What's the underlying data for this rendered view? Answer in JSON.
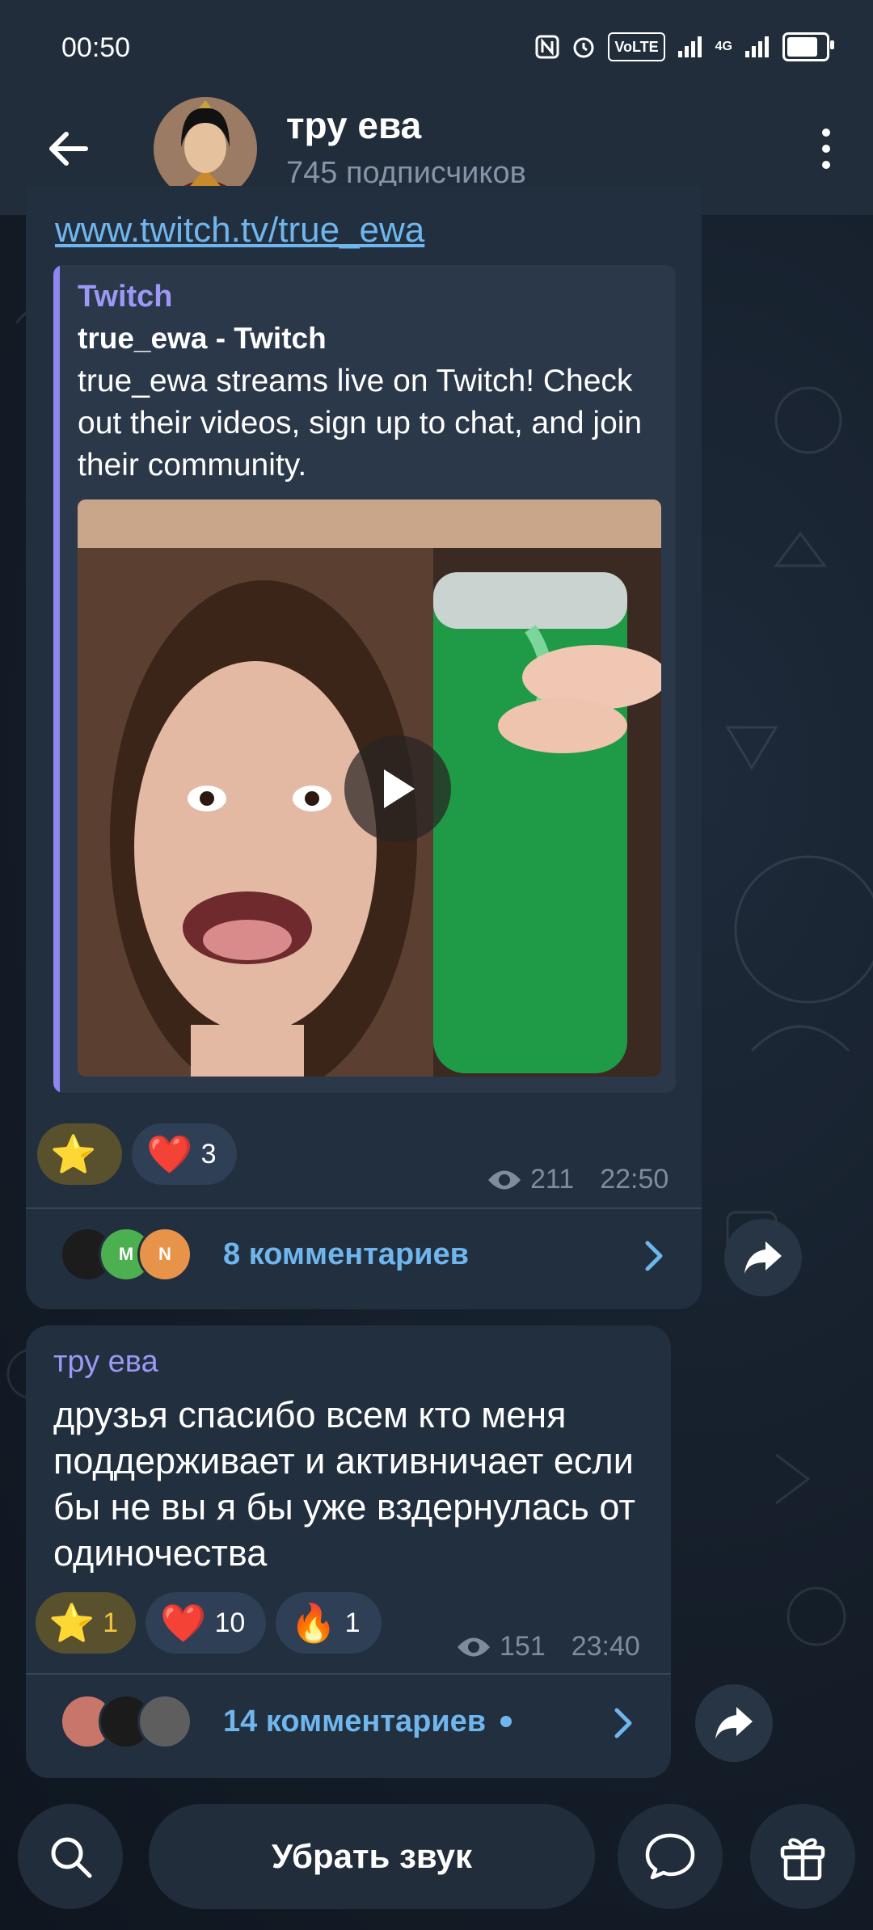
{
  "status_bar": {
    "time": "00:50",
    "network": "4G",
    "volte": "VoLTE",
    "battery_level": 0.8
  },
  "header": {
    "channel_name": "тру ева",
    "subscribers": "745 подписчиков",
    "back_icon": "arrow-left-icon",
    "menu_icon": "more-vertical-icon"
  },
  "post1": {
    "link": "www.twitch.tv/true_ewa",
    "preview": {
      "site": "Twitch",
      "title": "true_ewa - Twitch",
      "description": "true_ewa streams live on Twitch! Check out their videos, sign up to chat, and join their community."
    },
    "reactions": [
      {
        "emoji": "⭐",
        "count": ""
      },
      {
        "emoji": "❤️",
        "count": "3"
      }
    ],
    "views": "211",
    "time": "22:50",
    "comment_avatars": [
      "",
      "M",
      "N"
    ],
    "comments": "8 комментариев"
  },
  "post2": {
    "author": "тру ева",
    "text": "друзья спасибо всем кто меня поддерживает и активничает если бы не вы я бы уже вздернулась от одиночества",
    "reactions": [
      {
        "emoji": "⭐",
        "count": "1"
      },
      {
        "emoji": "❤️",
        "count": "10"
      },
      {
        "emoji": "🔥",
        "count": "1"
      }
    ],
    "views": "151",
    "time": "23:40",
    "comments": "14 комментариев"
  },
  "bottom_bar": {
    "mute_label": "Убрать звук",
    "search_icon": "search-icon",
    "chat_icon": "chat-bubble-icon",
    "gift_icon": "gift-icon"
  },
  "colors": {
    "accent_link": "#6fb6ee",
    "author_purple": "#9d97f5",
    "bubble": "#222f3e",
    "header": "#212d3b"
  }
}
